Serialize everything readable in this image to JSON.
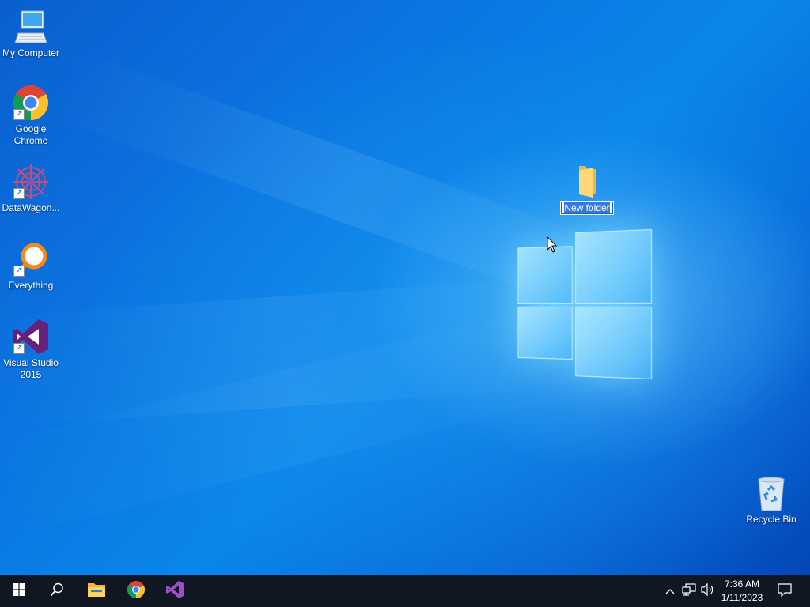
{
  "desktop": {
    "icons": [
      {
        "label": "My Computer",
        "icon": "computer-icon",
        "shortcut": false
      },
      {
        "label": "Google Chrome",
        "icon": "chrome-icon",
        "shortcut": true
      },
      {
        "label": "DataWagon...",
        "icon": "datawagon-icon",
        "shortcut": true
      },
      {
        "label": "Everything",
        "icon": "everything-search-icon",
        "shortcut": true
      },
      {
        "label": "Visual Studio 2015",
        "icon": "visual-studio-icon",
        "shortcut": true
      }
    ],
    "new_folder": {
      "label": "New folder",
      "state": "renaming"
    },
    "recycle_bin": {
      "label": "Recycle Bin"
    }
  },
  "taskbar": {
    "items": [
      {
        "name": "start",
        "icon": "windows-start-icon"
      },
      {
        "name": "search",
        "icon": "search-icon"
      },
      {
        "name": "file-explorer",
        "icon": "folder-icon"
      },
      {
        "name": "chrome",
        "icon": "chrome-icon"
      },
      {
        "name": "visual-studio",
        "icon": "visual-studio-icon"
      }
    ],
    "tray": {
      "chevron_icon": "chevron-up-icon",
      "network_icon": "network-icon",
      "volume_icon": "volume-icon",
      "notification_icon": "action-center-icon"
    },
    "clock": {
      "time": "7:36 AM",
      "date": "1/11/2023"
    }
  },
  "colors": {
    "taskbar_bg": "#101722",
    "desktop_blue": "#0a74e0",
    "selection_blue": "#3378e0"
  }
}
